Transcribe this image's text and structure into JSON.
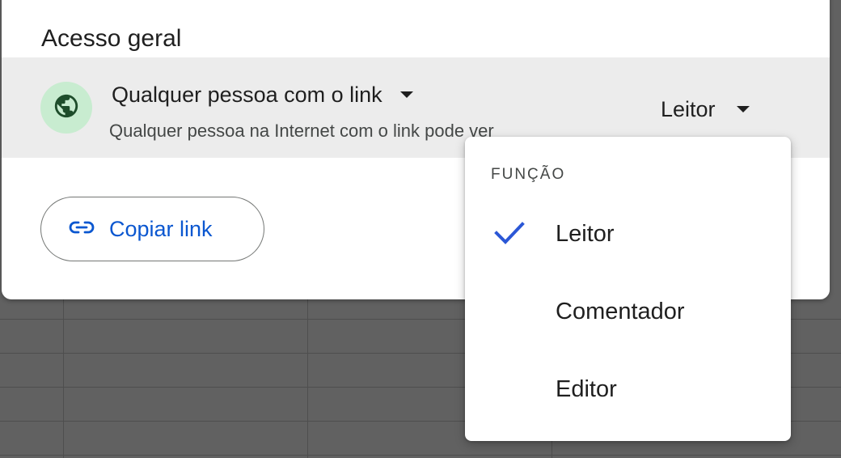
{
  "dialog": {
    "section_title": "Acesso geral",
    "general_access": {
      "icon": "globe-icon",
      "option_label": "Qualquer pessoa com o link",
      "description": "Qualquer pessoa na Internet com o link pode ver",
      "role_label": "Leitor"
    },
    "copy_link": {
      "icon": "link-icon",
      "label": "Copiar link"
    }
  },
  "role_menu": {
    "header": "FUNÇÃO",
    "items": [
      {
        "label": "Leitor",
        "selected": true
      },
      {
        "label": "Comentador",
        "selected": false
      },
      {
        "label": "Editor",
        "selected": false
      }
    ]
  },
  "colors": {
    "accent": "#0b57d0",
    "check": "#2b57d6",
    "globe_bg": "#c8ecd0",
    "globe": "#1e4d2b",
    "row_bg": "#ececec"
  }
}
